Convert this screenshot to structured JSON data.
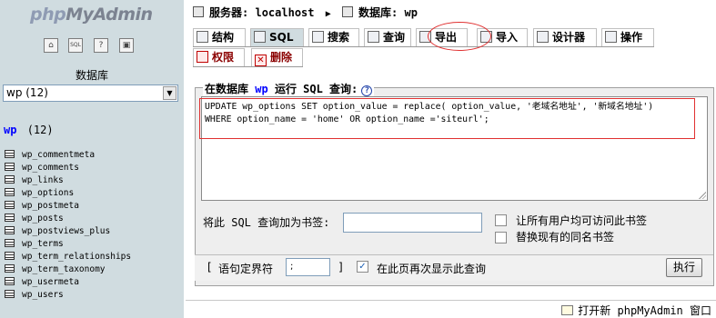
{
  "nav": {
    "logo_php": "php",
    "logo_myadmin": "MyAdmin",
    "icons": [
      "home-icon",
      "sql-icon",
      "help-icon",
      "query-window-icon"
    ],
    "icon_labels": [
      "⌂",
      "SQL",
      "?",
      "▣"
    ],
    "db_label": "数据库",
    "db_select_value": "wp (12)",
    "db_heading_name": "wp",
    "db_heading_count": "(12)",
    "tables": [
      "wp_commentmeta",
      "wp_comments",
      "wp_links",
      "wp_options",
      "wp_postmeta",
      "wp_posts",
      "wp_postviews_plus",
      "wp_terms",
      "wp_term_relationships",
      "wp_term_taxonomy",
      "wp_usermeta",
      "wp_users"
    ]
  },
  "breadcrumb": {
    "server_label": "服务器:",
    "server_value": "localhost",
    "separator": "▶",
    "db_label": "数据库:",
    "db_value": "wp"
  },
  "tabs": {
    "row1": [
      {
        "label": "结构",
        "icon": "structure-icon"
      },
      {
        "label": "SQL",
        "icon": "sql-icon"
      },
      {
        "label": "搜索",
        "icon": "search-icon"
      },
      {
        "label": "查询",
        "icon": "query-icon"
      },
      {
        "label": "导出",
        "icon": "export-icon"
      },
      {
        "label": "导入",
        "icon": "import-icon"
      },
      {
        "label": "设计器",
        "icon": "designer-icon"
      },
      {
        "label": "操作",
        "icon": "operations-icon"
      }
    ],
    "row2": [
      {
        "label": "权限",
        "icon": "privileges-icon"
      },
      {
        "label": "删除",
        "icon": "drop-icon"
      }
    ],
    "active": "SQL"
  },
  "sql_form": {
    "legend_prefix": "在数据库",
    "legend_db": "wp",
    "legend_suffix": "运行 SQL 查询:",
    "help_icon_label": "?",
    "query": "UPDATE wp_options SET option_value = replace( option_value, '老域名地址', '新域名地址')\nWHERE option_name = 'home' OR option_name ='siteurl';",
    "bookmark_label": "将此 SQL 查询加为书签:",
    "bookmark_value": "",
    "public_bookmark_label": "让所有用户均可访问此书签",
    "replace_bookmark_label": "替换现有的同名书签",
    "delimiter_open": "[",
    "delimiter_label": "语句定界符",
    "delimiter_value": ";",
    "delimiter_close": "]",
    "show_again_checked": "✓",
    "show_again_label": "在此页再次显示此查询",
    "go_label": "执行"
  },
  "footer": {
    "new_window_label": "打开新 phpMyAdmin 窗口"
  },
  "colors": {
    "nav_bg": "#d0dce0",
    "highlight": "#e03030",
    "db_link": "#0000ff"
  }
}
